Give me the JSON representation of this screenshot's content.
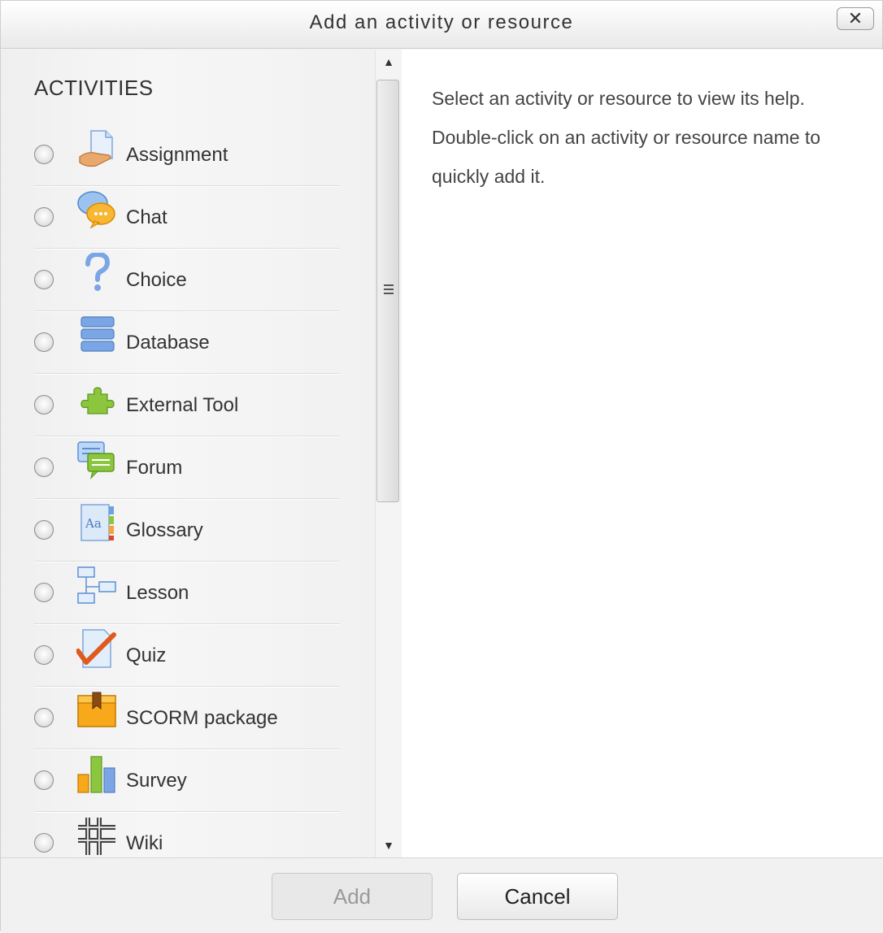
{
  "dialog": {
    "title": "Add an activity or resource",
    "close_label": "✕"
  },
  "activities": {
    "section_title": "ACTIVITIES",
    "items": [
      {
        "label": "Assignment",
        "icon": "assignment-icon"
      },
      {
        "label": "Chat",
        "icon": "chat-icon"
      },
      {
        "label": "Choice",
        "icon": "choice-icon"
      },
      {
        "label": "Database",
        "icon": "database-icon"
      },
      {
        "label": "External Tool",
        "icon": "external-tool-icon"
      },
      {
        "label": "Forum",
        "icon": "forum-icon"
      },
      {
        "label": "Glossary",
        "icon": "glossary-icon"
      },
      {
        "label": "Lesson",
        "icon": "lesson-icon"
      },
      {
        "label": "Quiz",
        "icon": "quiz-icon"
      },
      {
        "label": "SCORM package",
        "icon": "scorm-package-icon"
      },
      {
        "label": "Survey",
        "icon": "survey-icon"
      },
      {
        "label": "Wiki",
        "icon": "wiki-icon"
      }
    ]
  },
  "help": {
    "line1": "Select an activity or resource to view its help.",
    "line2": "Double-click on an activity or resource name to",
    "line3": "quickly add it."
  },
  "footer": {
    "add_label": "Add",
    "cancel_label": "Cancel"
  }
}
